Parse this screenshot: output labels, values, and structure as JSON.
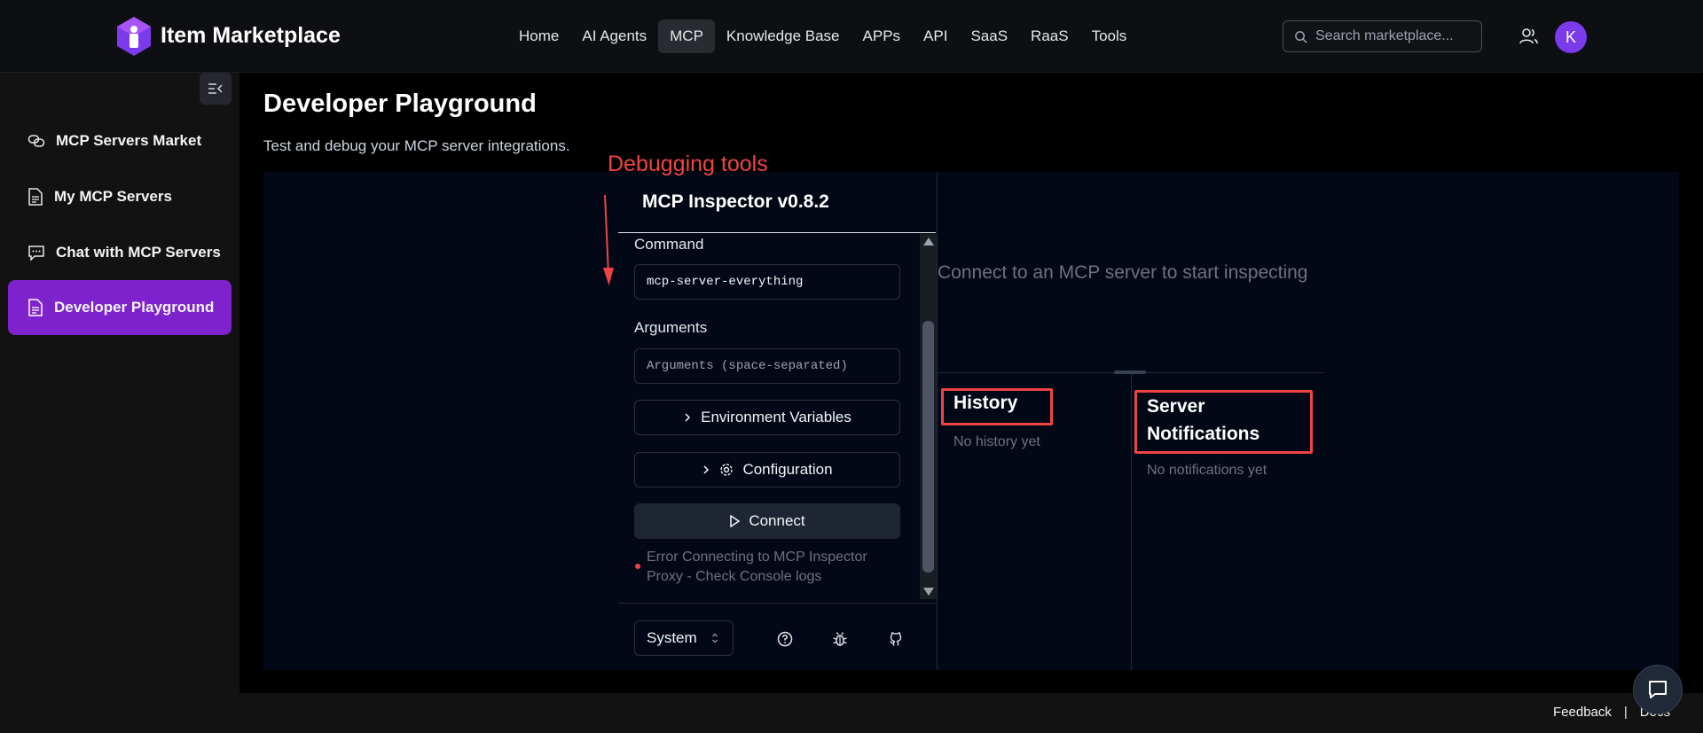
{
  "header": {
    "brand": "Item Marketplace",
    "nav": [
      "Home",
      "AI Agents",
      "MCP",
      "Knowledge Base",
      "APPs",
      "API",
      "SaaS",
      "RaaS",
      "Tools"
    ],
    "active_nav": "MCP",
    "search_placeholder": "Search marketplace...",
    "avatar_initial": "K"
  },
  "sidebar": {
    "items": [
      {
        "label": "MCP Servers Market",
        "icon": "link-icon"
      },
      {
        "label": "My MCP Servers",
        "icon": "document-icon"
      },
      {
        "label": "Chat with MCP Servers",
        "icon": "chat-icon"
      },
      {
        "label": "Developer Playground",
        "icon": "document-icon",
        "active": true
      }
    ]
  },
  "page": {
    "title": "Developer Playground",
    "subtitle": "Test and debug your MCP server integrations."
  },
  "annotation": {
    "label": "Debugging tools",
    "color": "#ef4444"
  },
  "inspector": {
    "title": "MCP Inspector v0.8.2",
    "command_label": "Command",
    "command_value": "mcp-server-everything",
    "arguments_label": "Arguments",
    "arguments_placeholder": "Arguments (space-separated)",
    "env_button": "Environment Variables",
    "config_button": "Configuration",
    "connect_button": "Connect",
    "error_text": "Error Connecting to MCP Inspector Proxy - Check Console logs",
    "theme_value": "System"
  },
  "panel": {
    "connect_message": "Connect to an MCP server to start inspecting",
    "history_title": "History",
    "history_empty": "No history yet",
    "notifications_title": "Server Notifications",
    "notifications_empty": "No notifications yet"
  },
  "footer": {
    "feedback": "Feedback",
    "separator": "|",
    "docs": "Docs"
  },
  "colors": {
    "accent": "#7e22ce",
    "avatar": "#7c3aed",
    "annotation": "#ef4444"
  }
}
